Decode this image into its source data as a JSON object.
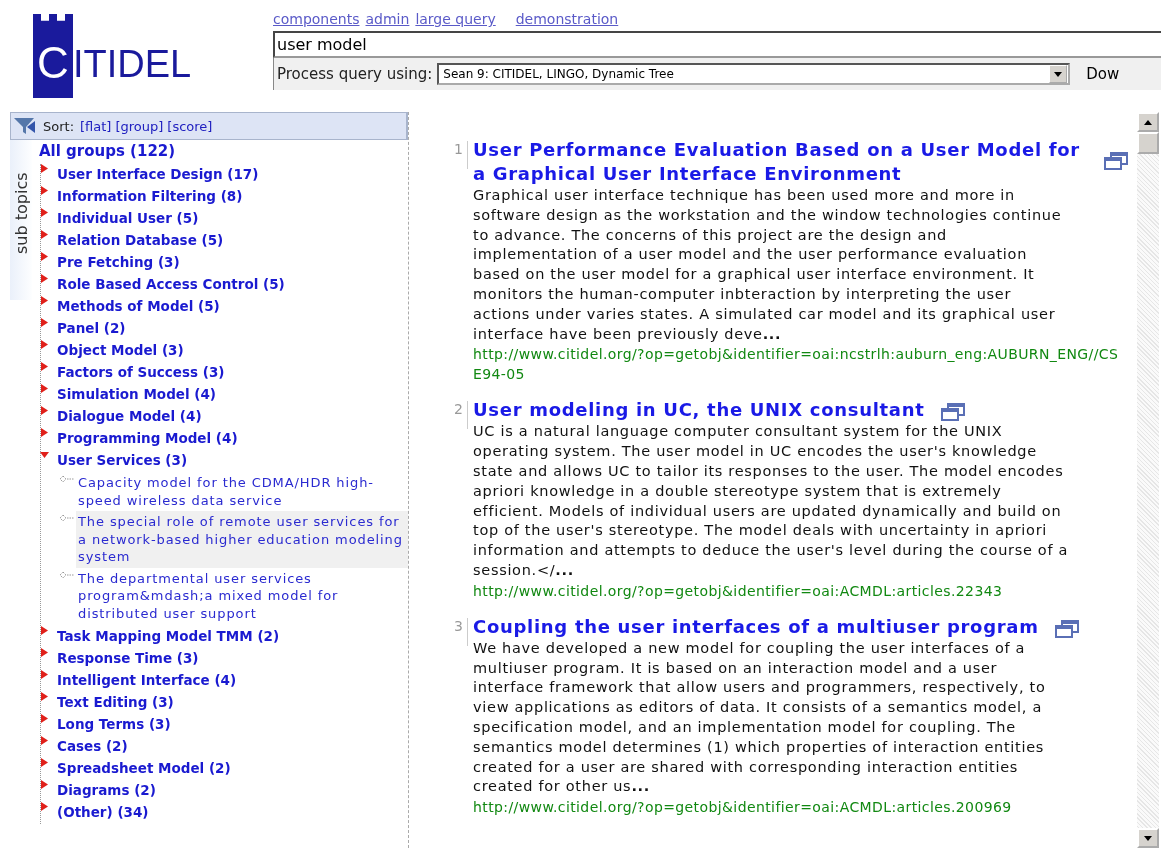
{
  "header": {
    "logo_initial": "C",
    "logo_text": "ITIDEL",
    "nav_links": [
      "components",
      "admin",
      "large query",
      "demonstration"
    ],
    "query": "user model",
    "process_label": "Process query using:",
    "process_select": "Sean 9: CITIDEL, LINGO, Dynamic Tree",
    "button_text": "Dow"
  },
  "sidebar": {
    "tab_label": "sub topics",
    "sort_label": "Sort:",
    "sort_options": [
      "[flat]",
      "[group]",
      "[score]"
    ],
    "root": "All groups (122)",
    "groups": [
      {
        "label": "User Interface Design (17)",
        "expanded": false
      },
      {
        "label": "Information Filtering (8)",
        "expanded": false
      },
      {
        "label": "Individual User (5)",
        "expanded": false
      },
      {
        "label": "Relation Database (5)",
        "expanded": false
      },
      {
        "label": "Pre Fetching (3)",
        "expanded": false
      },
      {
        "label": "Role Based Access Control (5)",
        "expanded": false
      },
      {
        "label": "Methods of Model (5)",
        "expanded": false
      },
      {
        "label": "Panel (2)",
        "expanded": false
      },
      {
        "label": "Object Model (3)",
        "expanded": false
      },
      {
        "label": "Factors of Success (3)",
        "expanded": false
      },
      {
        "label": "Simulation Model (4)",
        "expanded": false
      },
      {
        "label": "Dialogue Model (4)",
        "expanded": false
      },
      {
        "label": "Programming Model (4)",
        "expanded": false
      },
      {
        "label": "User Services (3)",
        "expanded": true,
        "children": [
          {
            "label": "Capacity model for the CDMA/HDR high-speed wireless data service",
            "selected": false
          },
          {
            "label": "The special role of remote user services for a network-based higher education modeling system",
            "selected": true
          },
          {
            "label": "The departmental user services program&mdash;a mixed model for distributed user support",
            "selected": false
          }
        ]
      },
      {
        "label": "Task Mapping Model TMM (2)",
        "expanded": false
      },
      {
        "label": "Response Time (3)",
        "expanded": false
      },
      {
        "label": "Intelligent Interface (4)",
        "expanded": false
      },
      {
        "label": "Text Editing (3)",
        "expanded": false
      },
      {
        "label": "Long Terms (3)",
        "expanded": false
      },
      {
        "label": "Cases (2)",
        "expanded": false
      },
      {
        "label": "Spreadsheet Model (2)",
        "expanded": false
      },
      {
        "label": "Diagrams (2)",
        "expanded": false
      },
      {
        "label": "(Other) (34)",
        "expanded": false
      }
    ]
  },
  "results": [
    {
      "number": "1",
      "title": "User Performance Evaluation Based on a User Model for a Graphical User Interface Environment",
      "snippet": "Graphical user interface technique has been used more and more in software design as the workstation and the window technologies continue to advance. The concerns of this project are the design and implementation of a user model and the user performance evaluation based on the user model for a graphical user interface environment. It monitors the human-computer inbteraction by interpreting the user actions under varies states. A simulated car model and its graphical user interface have been previously deve**...**",
      "url": "http://www.citidel.org/?op=getobj&identifier=oai:ncstrlh:auburn_eng:AUBURN_ENG//CSE94-05"
    },
    {
      "number": "2",
      "title": "User modeling in UC, the UNIX consultant",
      "snippet": "UC is a natural language computer consultant system for the UNIX operating system. The user model in UC encodes the user's knowledge state and allows UC to tailor its responses to the user. The model encodes apriori knowledge in a double stereotype system that is extremely efficient. Models of individual users are updated dynamically and build on top of the user's stereotype. The model deals with uncertainty in apriori information and attempts to deduce the user's level during the course of a session.</**...**",
      "url": "http://www.citidel.org/?op=getobj&identifier=oai:ACMDL:articles.22343"
    },
    {
      "number": "3",
      "title": "Coupling the user interfaces of a multiuser program",
      "snippet": "We have developed a new model for coupling the user interfaces of a multiuser program. It is based on an interaction model and a user interface framework that allow users and programmers, respectively, to view applications as editors of data. It consists of a semantics model, a specification model, and an implementation model for coupling. The semantics model determines (1) which properties of interaction entities created for a user are shared with corresponding interaction entities created for other us**...**",
      "url": "http://www.citidel.org/?op=getobj&identifier=oai:ACMDL:articles.200969"
    }
  ]
}
